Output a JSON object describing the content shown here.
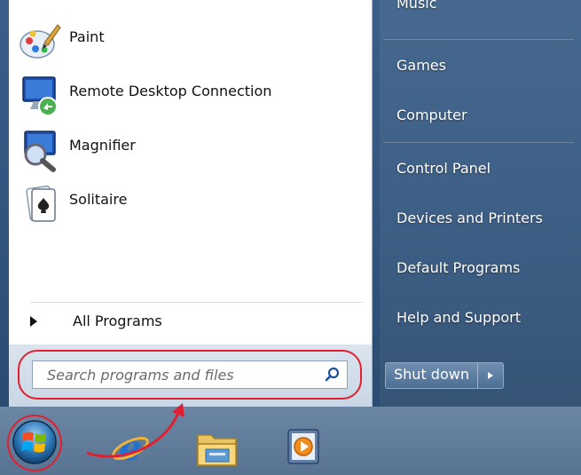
{
  "programs": [
    {
      "label": "Paint",
      "icon": "paint-icon"
    },
    {
      "label": "Remote Desktop Connection",
      "icon": "remote-desktop-icon"
    },
    {
      "label": "Magnifier",
      "icon": "magnifier-icon"
    },
    {
      "label": "Solitaire",
      "icon": "solitaire-icon"
    }
  ],
  "all_programs_label": "All Programs",
  "search": {
    "placeholder": "Search programs and files",
    "value": ""
  },
  "right_menu": [
    "Music",
    "Games",
    "Computer",
    "Control Panel",
    "Devices and Printers",
    "Default Programs",
    "Help and Support"
  ],
  "shutdown_label": "Shut down",
  "taskbar_icons": [
    "start-orb",
    "internet-explorer-icon",
    "windows-explorer-icon",
    "media-player-icon"
  ],
  "colors": {
    "annotation": "#e02030",
    "right_pane": "#47698f",
    "taskbar": "#6b87a4"
  }
}
